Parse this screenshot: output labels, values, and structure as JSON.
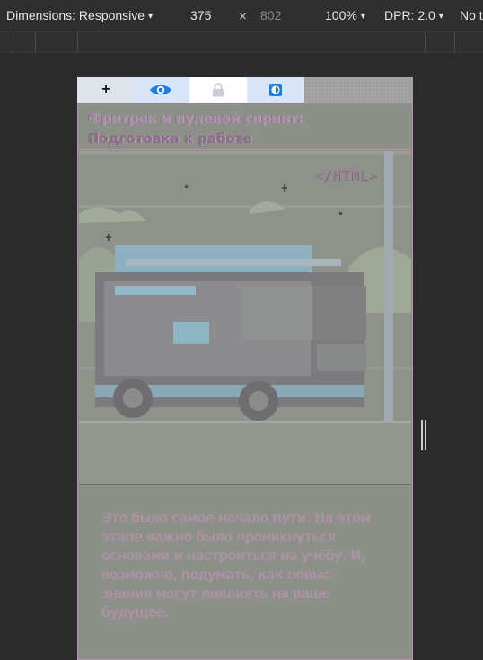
{
  "devtools": {
    "dimensions_label": "Dimensions: Responsive",
    "width_value": "375",
    "times": "×",
    "height_value": "802",
    "zoom": "100%",
    "dpr": "DPR: 2.0",
    "throttle": "No t",
    "arrow": "▾"
  },
  "extension_toolbar": {
    "add_label": "+",
    "icons": [
      "eye-icon",
      "lock-icon",
      "contrast-icon"
    ],
    "accent_color": "#1e7ce0"
  },
  "page": {
    "title_line1": "Фритрек и нулевой спринт:",
    "title_line2": "Подготовка к работе",
    "illustration_tag": "</HTML>",
    "body": "Это было самое начало пути. На этом этапе важно было проникнуться основами и настроиться на учёбу. И, возможно, подумать, как новые знания могут повлиять на ваше будущее."
  }
}
